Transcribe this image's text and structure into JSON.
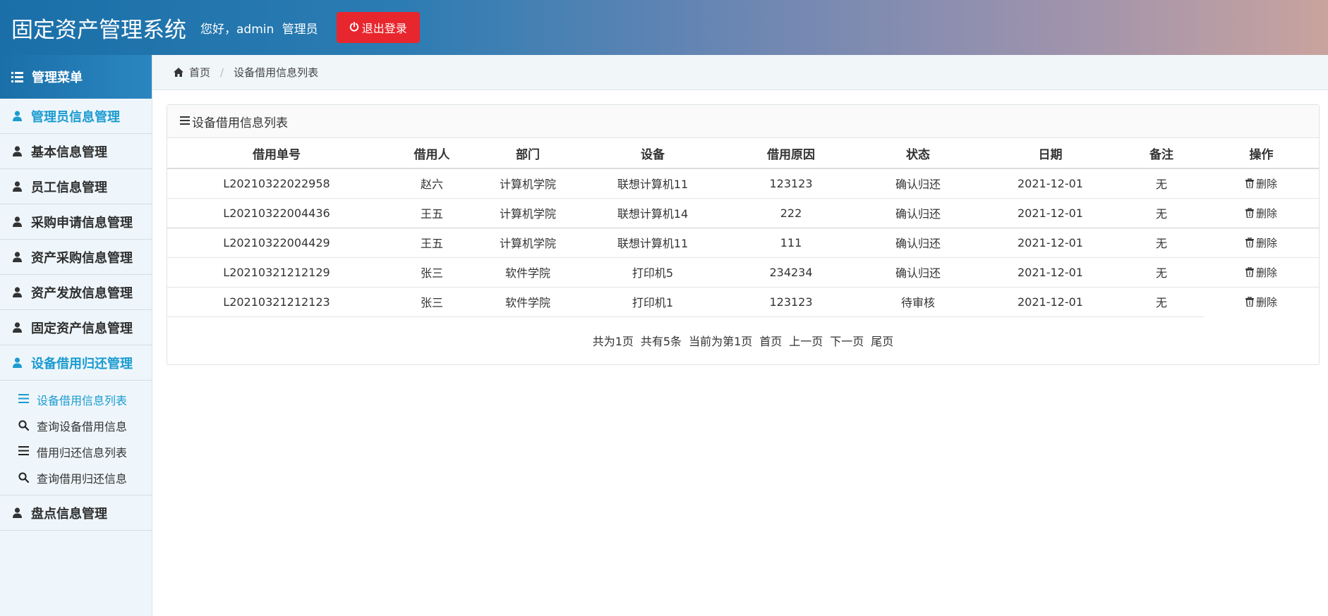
{
  "header": {
    "title": "固定资产管理系统",
    "greeting": "您好，admin",
    "role": "管理员",
    "logout_label": "退出登录"
  },
  "sidebar": {
    "menu_title": "管理菜单",
    "items": [
      {
        "label": "管理员信息管理",
        "icon": "user-icon",
        "active": true
      },
      {
        "label": "基本信息管理",
        "icon": "user-icon"
      },
      {
        "label": "员工信息管理",
        "icon": "user-icon"
      },
      {
        "label": "采购申请信息管理",
        "icon": "user-icon"
      },
      {
        "label": "资产采购信息管理",
        "icon": "user-icon"
      },
      {
        "label": "资产发放信息管理",
        "icon": "user-icon"
      },
      {
        "label": "固定资产信息管理",
        "icon": "user-icon"
      },
      {
        "label": "设备借用归还管理",
        "icon": "user-icon",
        "active": true
      },
      {
        "label": "盘点信息管理",
        "icon": "user-icon"
      }
    ],
    "subitems": [
      {
        "label": "设备借用信息列表",
        "icon": "list-icon",
        "active": true
      },
      {
        "label": "查询设备借用信息",
        "icon": "search-icon"
      },
      {
        "label": "借用归还信息列表",
        "icon": "list-icon"
      },
      {
        "label": "查询借用归还信息",
        "icon": "search-icon"
      }
    ]
  },
  "breadcrumb": {
    "home": "首页",
    "current": "设备借用信息列表"
  },
  "panel": {
    "title": "设备借用信息列表"
  },
  "table": {
    "columns": [
      "借用单号",
      "借用人",
      "部门",
      "设备",
      "借用原因",
      "状态",
      "日期",
      "备注",
      "操作"
    ],
    "rows": [
      {
        "id": "L20210322022958",
        "borrower": "赵六",
        "dept": "计算机学院",
        "device": "联想计算机11",
        "reason": "123123",
        "status": "确认归还",
        "date": "2021-12-01",
        "note": "无",
        "action": "删除"
      },
      {
        "id": "L20210322004436",
        "borrower": "王五",
        "dept": "计算机学院",
        "device": "联想计算机14",
        "reason": "222",
        "status": "确认归还",
        "date": "2021-12-01",
        "note": "无",
        "action": "删除"
      },
      {
        "id": "L20210322004429",
        "borrower": "王五",
        "dept": "计算机学院",
        "device": "联想计算机11",
        "reason": "111",
        "status": "确认归还",
        "date": "2021-12-01",
        "note": "无",
        "action": "删除"
      },
      {
        "id": "L20210321212129",
        "borrower": "张三",
        "dept": "软件学院",
        "device": "打印机5",
        "reason": "234234",
        "status": "确认归还",
        "date": "2021-12-01",
        "note": "无",
        "action": "删除"
      },
      {
        "id": "L20210321212123",
        "borrower": "张三",
        "dept": "软件学院",
        "device": "打印机1",
        "reason": "123123",
        "status": "待审核",
        "date": "2021-12-01",
        "note": "无",
        "action": "删除"
      }
    ]
  },
  "pager": {
    "total_pages": "共为1页",
    "total_items": "共有5条",
    "current": "当前为第1页",
    "first": "首页",
    "prev": "上一页",
    "next": "下一页",
    "last": "尾页"
  }
}
